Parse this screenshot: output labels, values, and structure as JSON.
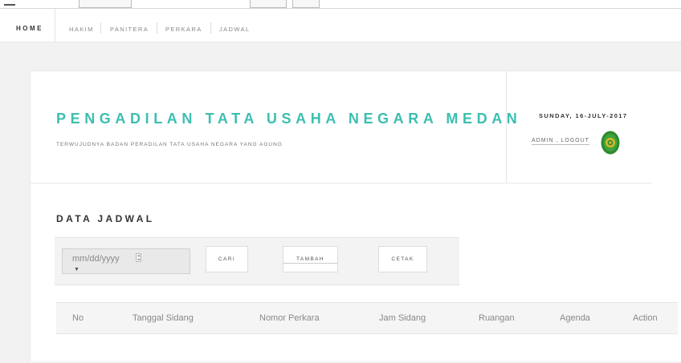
{
  "nav": {
    "home": "HOME",
    "items": [
      "HAKIM",
      "PANITERA",
      "PERKARA",
      "JADWAL"
    ]
  },
  "header": {
    "title": "PENGADILAN TATA USAHA NEGARA MEDAN",
    "subtitle": "TERWUJUDNYA BADAN PERADILAN TATA USAHA NEGARA YANG AGUNG",
    "date": "SUNDAY, 16-JULY-2017",
    "user_links": "ADMIN , LOGOUT"
  },
  "section": {
    "title": "DATA JADWAL"
  },
  "toolbar": {
    "date_placeholder": "mm/dd/yyyy",
    "dropdown_arrow": "▼",
    "cari_label": "CARI",
    "tambah_label": "TAMBAH",
    "cetak_label": "CETAK"
  },
  "table": {
    "columns": [
      "No",
      "Tanggal Sidang",
      "Nomor Perkara",
      "Jam Sidang",
      "Ruangan",
      "Agenda",
      "Action"
    ]
  },
  "colors": {
    "accent": "#3cbfb0",
    "logo_green": "#2e8b2e",
    "logo_gold": "#d8b82a"
  }
}
